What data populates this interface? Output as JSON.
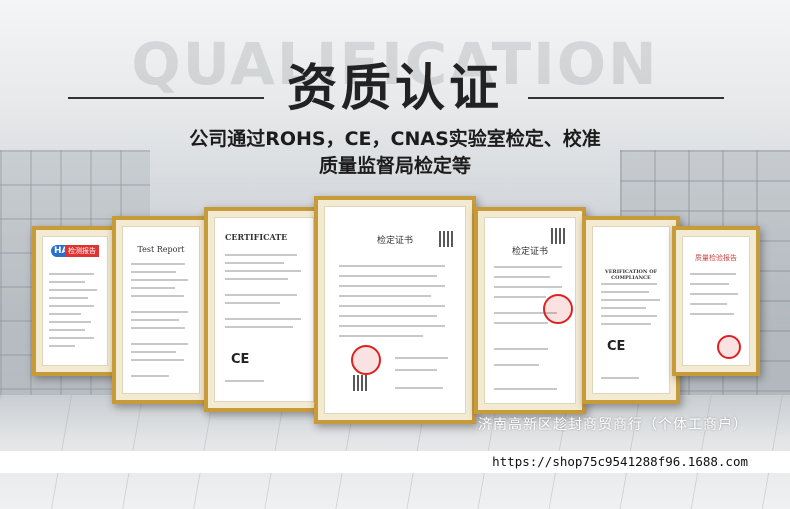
{
  "background": {
    "word": "QUALIFICATION"
  },
  "header": {
    "title": "资质认证",
    "subtitle_line1": "公司通过ROHS，CE，CNAS实验室检定、校准",
    "subtitle_line2": "质量监督局检定等"
  },
  "certificates": [
    {
      "id": "cert-1",
      "header": "HAP",
      "badge": "检测报告"
    },
    {
      "id": "cert-2",
      "header": "Test Report"
    },
    {
      "id": "cert-3",
      "header": "CERTIFICATE",
      "mark": "CE"
    },
    {
      "id": "cert-4",
      "header": "检定证书"
    },
    {
      "id": "cert-5",
      "header": "检定证书"
    },
    {
      "id": "cert-6",
      "header": "VERIFICATION OF COMPLIANCE",
      "mark": "CE"
    },
    {
      "id": "cert-7",
      "header": "质量检验报告"
    }
  ],
  "watermark": "济南高新区趁封商贸商行（个体工商户）",
  "footer": {
    "url": "https://shop75c9541288f96.1688.com"
  },
  "colors": {
    "frame": "#c79b3a",
    "title": "#222222",
    "seal": "#d22222"
  }
}
